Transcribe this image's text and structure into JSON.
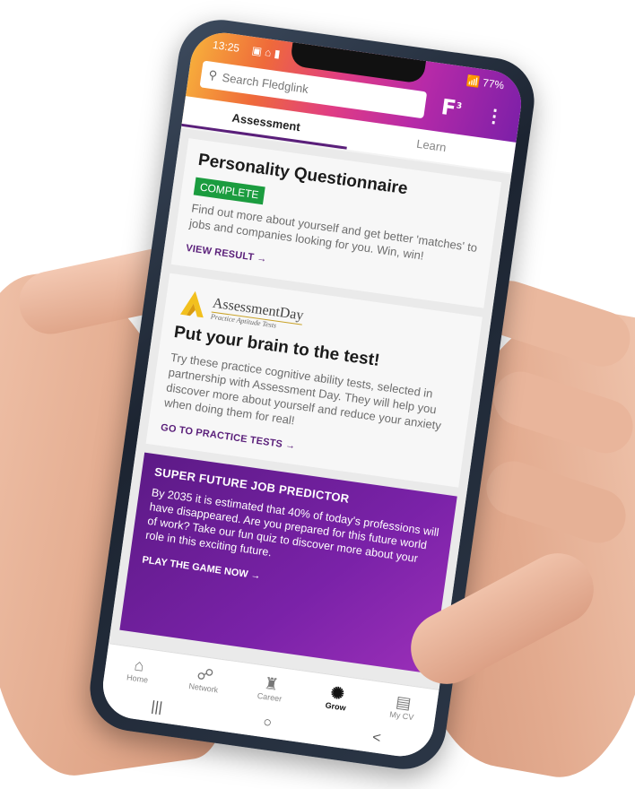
{
  "status": {
    "time": "13:25",
    "battery": "77%",
    "left_icons": "▣ ⌂ ▮",
    "right_icons": "📶"
  },
  "search": {
    "placeholder": "Search Fledglink"
  },
  "header": {
    "logo": "F",
    "logo_badge": "3",
    "menu_icon": "⋮"
  },
  "tabs": [
    {
      "label": "Assessment",
      "active": true
    },
    {
      "label": "Learn",
      "active": false
    }
  ],
  "cards": {
    "personality": {
      "title": "Personality Questionnaire",
      "badge": "COMPLETE",
      "description": "Find out more about yourself and get better 'matches' to jobs and companies looking for you. Win, win!",
      "link": "VIEW RESULT →"
    },
    "brain": {
      "logo_name": "AssessmentDay",
      "logo_sub": "Practice Aptitude Tests",
      "title": "Put your brain to the test!",
      "description": "Try these practice cognitive ability tests, selected in partnership with Assessment Day. They will help you discover more about yourself and reduce your anxiety when doing them for real!",
      "link": "GO TO PRACTICE TESTS →"
    },
    "promo": {
      "title": "SUPER FUTURE JOB PREDICTOR",
      "description": "By 2035 it is estimated that 40% of today's professions will have disappeared. Are you prepared for this future world of work? Take our fun quiz to discover more about your role in this exciting future.",
      "link": "PLAY THE GAME NOW →"
    }
  },
  "bottom_nav": [
    {
      "label": "Home",
      "icon": "⌂"
    },
    {
      "label": "Network",
      "icon": "☍"
    },
    {
      "label": "Career",
      "icon": "♜"
    },
    {
      "label": "Grow",
      "icon": "✺",
      "active": true
    },
    {
      "label": "My CV",
      "icon": "▤"
    }
  ],
  "system_nav": {
    "recent": "|||",
    "home": "○",
    "back": "<"
  },
  "colors": {
    "brand_purple": "#5a1f7a",
    "complete_green": "#1b9c3f"
  }
}
